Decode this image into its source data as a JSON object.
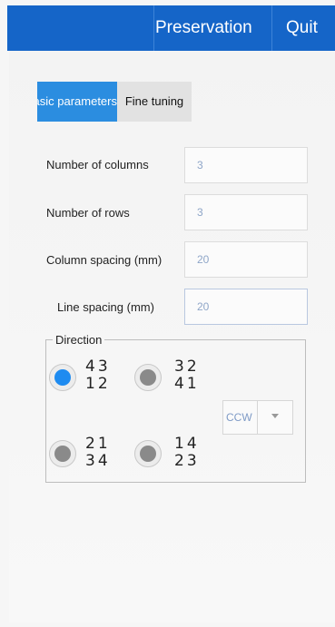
{
  "header": {
    "save_label": "Preservation",
    "quit_label": "Quit",
    "accent": "#1565c8"
  },
  "tabs": [
    {
      "label": "Basic parameters",
      "active": true
    },
    {
      "label": "Fine tuning",
      "active": false
    }
  ],
  "fields": {
    "columns": {
      "label": "Number of columns",
      "value": "3"
    },
    "rows": {
      "label": "Number of rows",
      "value": "3"
    },
    "column_spacing": {
      "label": "Column spacing (mm)",
      "value": "20"
    },
    "line_spacing": {
      "label": "Line spacing (mm)",
      "value": "20"
    }
  },
  "direction": {
    "legend": "Direction",
    "options": [
      {
        "top": "43",
        "bottom": "12",
        "selected": true
      },
      {
        "top": "32",
        "bottom": "41",
        "selected": false
      },
      {
        "top": "21",
        "bottom": "34",
        "selected": false
      },
      {
        "top": "14",
        "bottom": "23",
        "selected": false
      }
    ],
    "rotation": {
      "selected": "CCW",
      "icon": "chevron-down-icon"
    }
  }
}
